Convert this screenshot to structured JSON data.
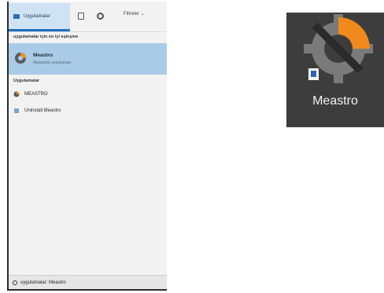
{
  "tabs": {
    "apps_label": "Uygulamalar",
    "more_label": "Filtreler"
  },
  "best_match": {
    "heading": "uygulamalar için en iyi eşleşme",
    "title": "Meastro",
    "subtitle": "Masaüstü uygulaması"
  },
  "apps_section": {
    "heading": "Uygulamalar",
    "items": [
      {
        "label": "MEASTRO",
        "icon": "meastro-icon"
      },
      {
        "label": "Uninstall Meastro",
        "icon": "uninstall-icon"
      }
    ]
  },
  "search": {
    "value": "uygulamalar: Meastro"
  },
  "desktop_icon": {
    "label": "Meastro"
  },
  "colors": {
    "accent": "#1f6fc1",
    "selected_row": "#a9cbe8",
    "brand_orange": "#f08a1c",
    "desktop_tile": "#3d3d3d"
  }
}
